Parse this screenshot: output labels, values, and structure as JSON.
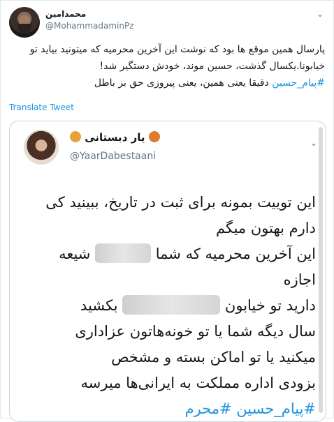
{
  "tweet": {
    "author_name": "محمدامین",
    "author_handle": "@MohammadaminPz",
    "text_main": "پارسال همین موقع ها بود که نوشت این آخرین محرمیه که میتونید بیاید تو خیابونا.یکسال گذشت، حسین موند، خودش دستگیر شد!",
    "hashtag": "#پیام_حسین",
    "text_after_hashtag": "دقیقا یعنی همین، یعنی پیروزی حق بر باطل",
    "translate_label": "Translate Tweet"
  },
  "quoted": {
    "author_name": "یار دبستانی",
    "author_handle": "@YaarDabestaani",
    "lines": [
      "این توییت بمونه برای ثبت در تاریخ، ببینید کی",
      "دارم بهتون میگم",
      "این آخرین محرمیه که شما",
      "شیعه اجازه",
      "دارید تو خیابون",
      "بکشید",
      "سال دیگه شما یا تو خونه‌هاتون عزاداری",
      "میکنید یا تو اماکن بسته و مشخص",
      "بزودی اداره مملکت به ایرانی‌ها میرسه"
    ],
    "hashtags": "#پیام_حسین #محرم"
  },
  "icons": {
    "caret": "chevron-down-icon",
    "emoji_left": "smiling-face-icon",
    "emoji_right": "lion-face-icon"
  },
  "colors": {
    "link": "#1b95e0",
    "secondary": "#657786",
    "border": "#ccd6dd"
  }
}
